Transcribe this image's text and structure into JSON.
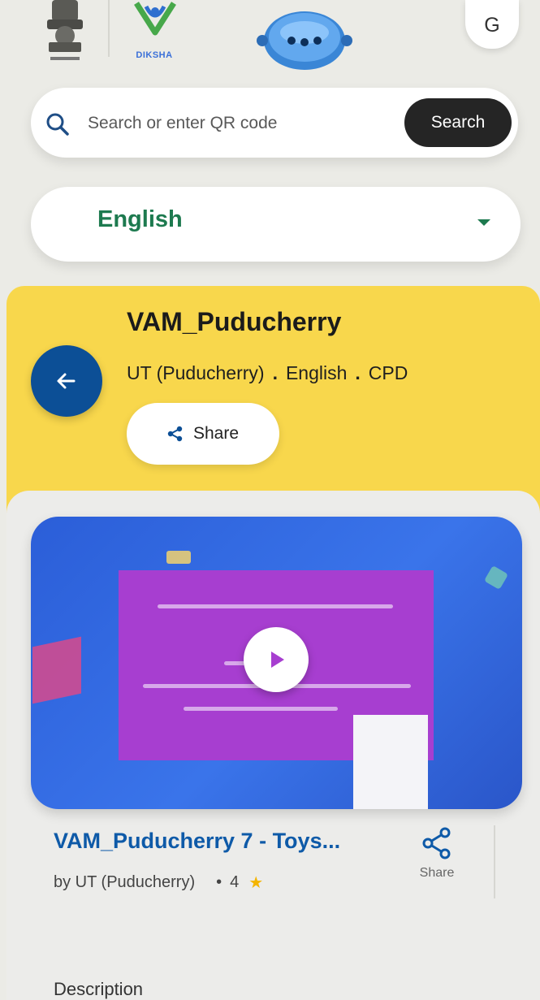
{
  "header": {
    "diksha_logo_text": "DIKSHA",
    "avatar_initial": "G"
  },
  "search": {
    "placeholder": "Search or enter QR code",
    "button_label": "Search"
  },
  "language": {
    "selected": "English"
  },
  "course": {
    "title": "VAM_Puducherry",
    "board": "UT (Puducherry)",
    "medium": "English",
    "type": "CPD",
    "separator": ".",
    "share_label": "Share"
  },
  "content_card": {
    "title": "VAM_Puducherry 7 - Toys...",
    "author": "by UT (Puducherry)",
    "bullet": "•",
    "rating": "4",
    "star": "★",
    "share_label": "Share"
  },
  "description": {
    "heading": "Description"
  },
  "colors": {
    "banner": "#f8d74c",
    "back_button": "#0c4f96",
    "language_text": "#1d7a4f",
    "card_title": "#0e5aa8",
    "search_button": "#252525"
  }
}
